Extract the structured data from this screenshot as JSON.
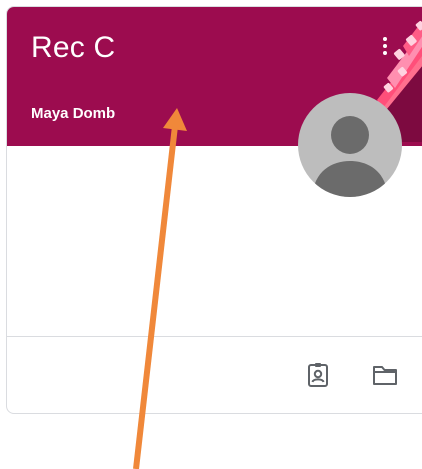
{
  "card": {
    "title": "Rec C",
    "teacher": "Maya Domb",
    "more_menu_icon": "more-vert-icon",
    "avatar_icon": "person-avatar-icon",
    "footer_icons": [
      "assignment-ind-icon",
      "folder-icon"
    ]
  },
  "colors": {
    "header_background": "#9c0c4f",
    "avatar_background": "#bdbdbd",
    "avatar_figure": "#6b6b6b",
    "footer_icon": "#5f6368",
    "annotation_arrow": "#f0883a"
  }
}
